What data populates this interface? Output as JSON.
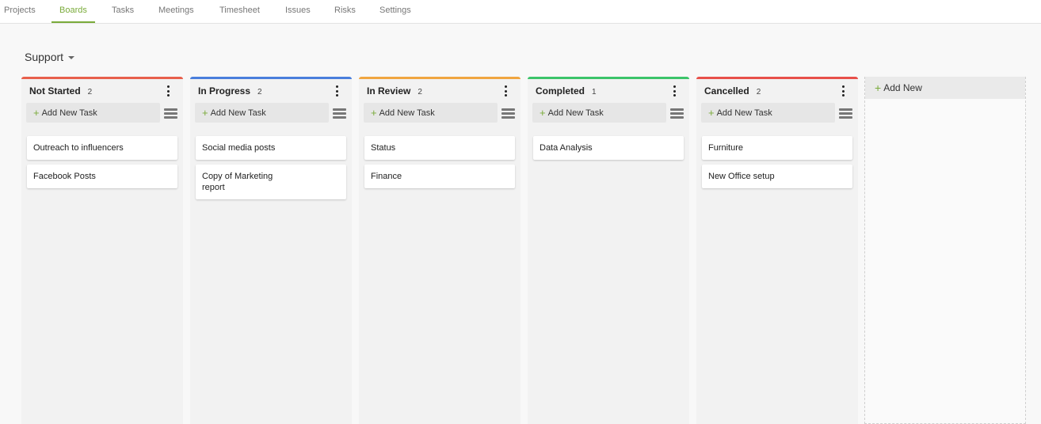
{
  "nav": {
    "tabs": [
      {
        "label": "Projects"
      },
      {
        "label": "Boards"
      },
      {
        "label": "Tasks"
      },
      {
        "label": "Meetings"
      },
      {
        "label": "Timesheet"
      },
      {
        "label": "Issues"
      },
      {
        "label": "Risks"
      },
      {
        "label": "Settings"
      }
    ],
    "active_tab": "Boards"
  },
  "board": {
    "title": "Support"
  },
  "add_task_label": "Add New Task",
  "columns": [
    {
      "title": "Not Started",
      "count": "2",
      "color": "#e8604c",
      "cards": [
        {
          "text": "Outreach to influencers"
        },
        {
          "text": "Facebook Posts"
        }
      ]
    },
    {
      "title": "In Progress",
      "count": "2",
      "color": "#4a7fdc",
      "cards": [
        {
          "text": "Social media posts"
        },
        {
          "text": "Copy of Marketing report"
        }
      ]
    },
    {
      "title": "In Review",
      "count": "2",
      "color": "#f0a640",
      "cards": [
        {
          "text": "Status"
        },
        {
          "text": "Finance"
        }
      ]
    },
    {
      "title": "Completed",
      "count": "1",
      "color": "#3cc46a",
      "cards": [
        {
          "text": "Data Analysis"
        }
      ]
    },
    {
      "title": "Cancelled",
      "count": "2",
      "color": "#e8504a",
      "cards": [
        {
          "text": "Furniture"
        },
        {
          "text": "New Office setup"
        }
      ]
    }
  ],
  "add_new_column_label": "Add New",
  "icons": {
    "caret": "chevron-down-icon",
    "menu": "kebab-menu-icon",
    "list": "list-view-icon",
    "plus": "plus-icon"
  },
  "colors": {
    "accent": "#7aab3a"
  }
}
